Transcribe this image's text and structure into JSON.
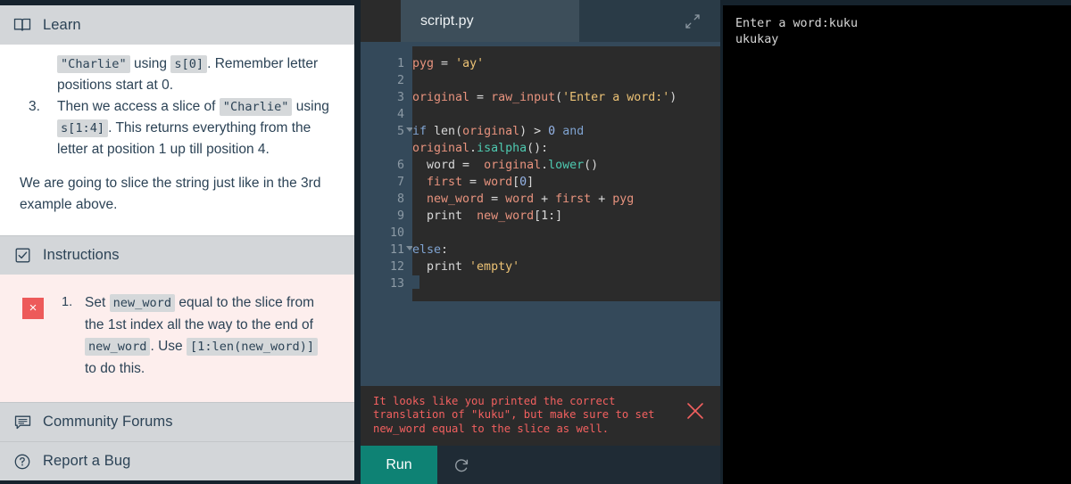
{
  "left_panel": {
    "learn": {
      "title": "Learn",
      "icon": "book-icon",
      "continued_text_parts": [
        {
          "t": "code",
          "v": "\"Charlie\""
        },
        {
          "t": "text",
          "v": " using "
        },
        {
          "t": "code",
          "v": "s[0]"
        },
        {
          "t": "text",
          "v": ". Remember letter positions start at 0."
        }
      ],
      "item3": {
        "number": "3.",
        "parts": [
          {
            "t": "text",
            "v": "Then we access a slice of "
          },
          {
            "t": "code",
            "v": "\"Charlie\""
          },
          {
            "t": "text",
            "v": " using "
          },
          {
            "t": "code",
            "v": "s[1:4]"
          },
          {
            "t": "text",
            "v": ". This returns everything from the letter at position 1 up till position 4."
          }
        ]
      },
      "closing_paragraph": "We are going to slice the string just like in the 3rd example above."
    },
    "instructions": {
      "title": "Instructions",
      "icon": "checkbox-checked-icon",
      "status": "failed",
      "status_mark": "×",
      "item_number": "1.",
      "parts": [
        {
          "t": "text",
          "v": "Set "
        },
        {
          "t": "code",
          "v": "new_word"
        },
        {
          "t": "text",
          "v": " equal to the slice from the 1st index all the way to the end of "
        },
        {
          "t": "code",
          "v": "new_word"
        },
        {
          "t": "text",
          "v": ". Use "
        },
        {
          "t": "code",
          "v": "[1:len(new_word)]"
        },
        {
          "t": "text",
          "v": " to do this."
        }
      ]
    },
    "community_forums": {
      "title": "Community Forums",
      "icon": "speech-bubble-icon"
    },
    "report_a_bug": {
      "title": "Report a Bug",
      "icon": "question-circle-icon"
    }
  },
  "editor": {
    "tab_label": "script.py",
    "expand_icon": "expand-diagonal-icon",
    "line_numbers": [
      "1",
      "2",
      "3",
      "4",
      "5",
      "6",
      "7",
      "8",
      "9",
      "10",
      "11",
      "12",
      "13"
    ],
    "fold_lines": [
      "5",
      "11"
    ],
    "code_lines": [
      {
        "n": "1",
        "tokens": [
          {
            "c": "var",
            "v": "pyg"
          },
          {
            "c": "op",
            "v": " = "
          },
          {
            "c": "str",
            "v": "'ay'"
          }
        ]
      },
      {
        "n": "2",
        "tokens": []
      },
      {
        "n": "3",
        "tokens": [
          {
            "c": "var",
            "v": "original"
          },
          {
            "c": "op",
            "v": " = "
          },
          {
            "c": "var",
            "v": "raw_input"
          },
          {
            "c": "punct",
            "v": "("
          },
          {
            "c": "str",
            "v": "'Enter a word:'"
          },
          {
            "c": "punct",
            "v": ")"
          }
        ]
      },
      {
        "n": "4",
        "tokens": []
      },
      {
        "n": "5",
        "tokens": [
          {
            "c": "kw",
            "v": "if "
          },
          {
            "c": "plain",
            "v": "len"
          },
          {
            "c": "punct",
            "v": "("
          },
          {
            "c": "var",
            "v": "original"
          },
          {
            "c": "punct",
            "v": ")"
          },
          {
            "c": "op",
            "v": " > "
          },
          {
            "c": "num",
            "v": "0"
          },
          {
            "c": "kw",
            "v": " and "
          },
          {
            "c": "var",
            "v": "original"
          },
          {
            "c": "punct",
            "v": "."
          },
          {
            "c": "fn",
            "v": "isalpha"
          },
          {
            "c": "punct",
            "v": "():"
          }
        ]
      },
      {
        "n": "6",
        "tokens": [
          {
            "c": "plain",
            "v": "  word"
          },
          {
            "c": "op",
            "v": " =  "
          },
          {
            "c": "var",
            "v": "original"
          },
          {
            "c": "punct",
            "v": "."
          },
          {
            "c": "fn",
            "v": "lower"
          },
          {
            "c": "punct",
            "v": "()"
          }
        ]
      },
      {
        "n": "7",
        "tokens": [
          {
            "c": "var",
            "v": "  first"
          },
          {
            "c": "op",
            "v": " = "
          },
          {
            "c": "var",
            "v": "word"
          },
          {
            "c": "punct",
            "v": "["
          },
          {
            "c": "num",
            "v": "0"
          },
          {
            "c": "punct",
            "v": "]"
          }
        ]
      },
      {
        "n": "8",
        "tokens": [
          {
            "c": "var",
            "v": "  new_word"
          },
          {
            "c": "op",
            "v": " = "
          },
          {
            "c": "var",
            "v": "word"
          },
          {
            "c": "op",
            "v": " + "
          },
          {
            "c": "var",
            "v": "first"
          },
          {
            "c": "op",
            "v": " + "
          },
          {
            "c": "var",
            "v": "pyg"
          }
        ]
      },
      {
        "n": "9",
        "tokens": [
          {
            "c": "plain",
            "v": "  print  "
          },
          {
            "c": "var",
            "v": "new_word"
          },
          {
            "c": "punct",
            "v": "[1:]"
          }
        ]
      },
      {
        "n": "10",
        "tokens": []
      },
      {
        "n": "11",
        "tokens": [
          {
            "c": "kw",
            "v": "else"
          },
          {
            "c": "punct",
            "v": ":"
          }
        ]
      },
      {
        "n": "12",
        "tokens": [
          {
            "c": "plain",
            "v": "  print "
          },
          {
            "c": "str",
            "v": "'empty'"
          }
        ]
      },
      {
        "n": "13",
        "tokens": []
      }
    ],
    "console_message": "It looks like you printed the correct translation of \"kuku\", but make sure to set new_word equal to the slice as well.",
    "console_close_icon": "close-x-icon",
    "run_label": "Run",
    "reset_icon": "refresh-icon"
  },
  "terminal": {
    "lines": [
      "Enter a word:kuku",
      "ukukay"
    ],
    "text": "Enter a word:kuku\nukukay"
  },
  "colors": {
    "accent_run": "#0e8274",
    "error_red": "#f2605f",
    "fail_badge": "#ed5a5a",
    "panel_header": "#d3d6d9",
    "instructions_bg": "#fdeeed",
    "editor_bg": "#2b2b2b",
    "editor_surround": "#34495a",
    "terminal_bg": "#000000",
    "text_dark": "#2c4356"
  }
}
